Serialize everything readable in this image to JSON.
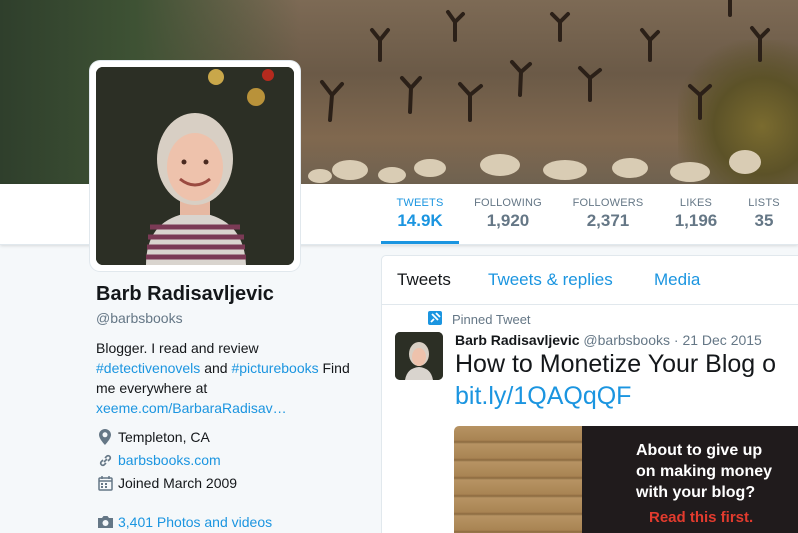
{
  "profile": {
    "name": "Barb Radisavljevic",
    "handle": "@barbsbooks",
    "bio_text_1": "Blogger. I read and review",
    "bio_tag_1": "#detectivenovels",
    "bio_and": "and",
    "bio_tag_2": "#picturebooks",
    "bio_text_2": "Find me everywhere at",
    "bio_link": "xeeme.com/BarbaraRadisav…",
    "location": "Templeton, CA",
    "website": "barbsbooks.com",
    "joined": "Joined March 2009",
    "photos": "3,401 Photos and videos"
  },
  "stats": [
    {
      "label": "TWEETS",
      "value": "14.9K"
    },
    {
      "label": "FOLLOWING",
      "value": "1,920"
    },
    {
      "label": "FOLLOWERS",
      "value": "2,371"
    },
    {
      "label": "LIKES",
      "value": "1,196"
    },
    {
      "label": "LISTS",
      "value": "35"
    }
  ],
  "timeline": {
    "tabs": [
      "Tweets",
      "Tweets & replies",
      "Media"
    ],
    "pinned_label": "Pinned Tweet",
    "tweet": {
      "author": "Barb Radisavljevic",
      "handle": "@barbsbooks",
      "date": "· 21 Dec 2015",
      "text": "How to Monetize Your Blog o",
      "link": "bit.ly/1QAQqQF"
    },
    "media": {
      "teaser_1": "About to give up",
      "teaser_2": "on making money",
      "teaser_3": "with your blog?",
      "cta": "Read this first."
    }
  },
  "colors": {
    "accent": "#1b95e0",
    "text": "#14171a",
    "muted": "#657786",
    "background": "#f5f8fa"
  },
  "icons": {
    "location": "map-pin-icon",
    "website": "link-icon",
    "joined": "calendar-icon",
    "photos": "camera-icon",
    "pinned": "pin-icon"
  }
}
